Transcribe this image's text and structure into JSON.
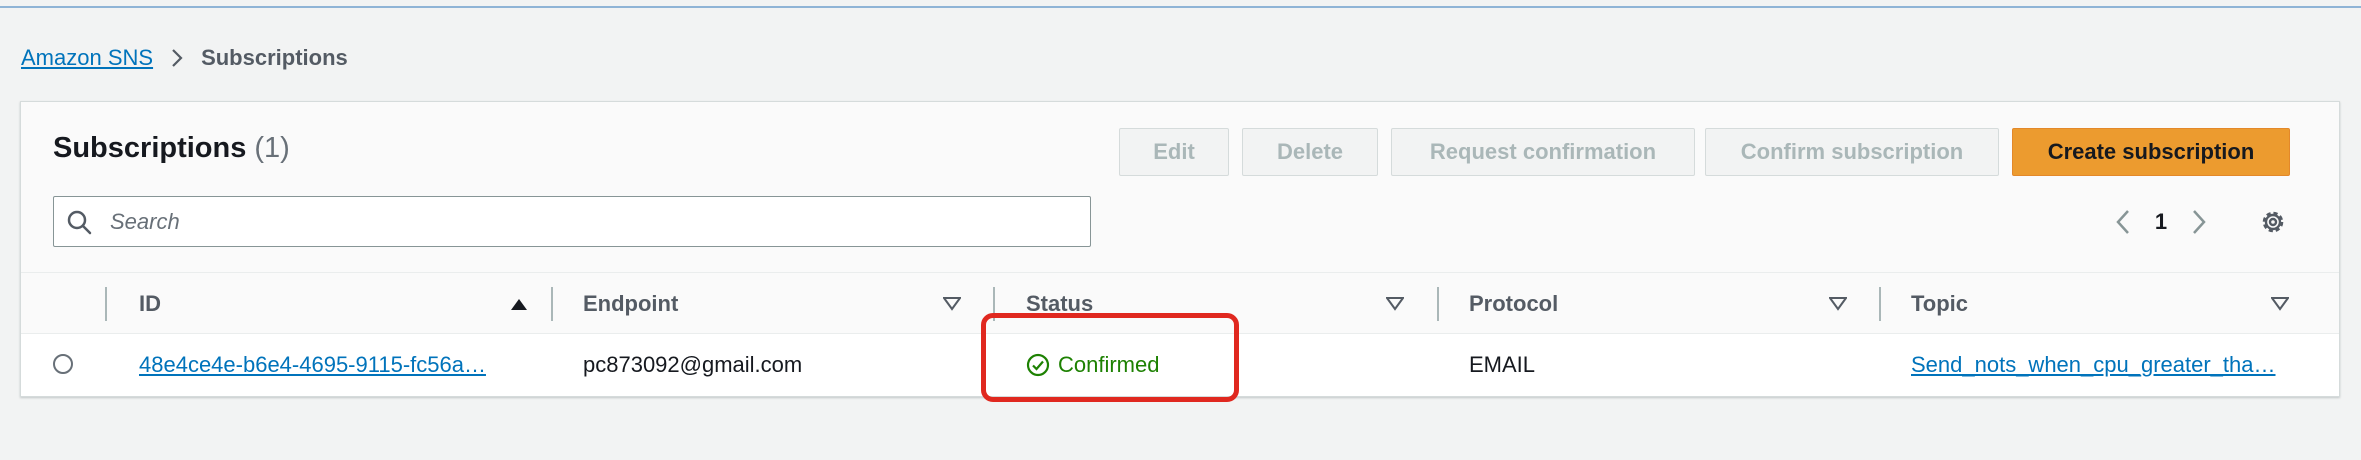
{
  "breadcrumb": {
    "root": "Amazon SNS",
    "current": "Subscriptions"
  },
  "panel": {
    "title": "Subscriptions",
    "count": "(1)",
    "buttons": {
      "edit": "Edit",
      "delete": "Delete",
      "request_confirmation": "Request confirmation",
      "confirm_subscription": "Confirm subscription",
      "create_subscription": "Create subscription"
    },
    "search": {
      "placeholder": "Search",
      "value": ""
    },
    "pagination": {
      "page": "1"
    }
  },
  "table": {
    "columns": [
      "ID",
      "Endpoint",
      "Status",
      "Protocol",
      "Topic"
    ],
    "rows": [
      {
        "id": "48e4ce4e-b6e4-4695-9115-fc56a…",
        "endpoint": "pc873092@gmail.com",
        "status": "Confirmed",
        "protocol": "EMAIL",
        "topic": "Send_nots_when_cpu_greater_tha…"
      }
    ]
  },
  "colors": {
    "link": "#0073bb",
    "primary_button": "#ec9b2f",
    "status_success": "#1d8102",
    "highlight": "#e0281f"
  },
  "icons": {
    "breadcrumb_separator": "chevron-right-icon",
    "search": "search-icon",
    "prev": "chevron-left-icon",
    "next": "chevron-right-icon",
    "settings": "gear-icon",
    "sort_asc": "sort-ascending-icon",
    "sort": "sort-descending-icon",
    "status": "check-circle-icon"
  }
}
